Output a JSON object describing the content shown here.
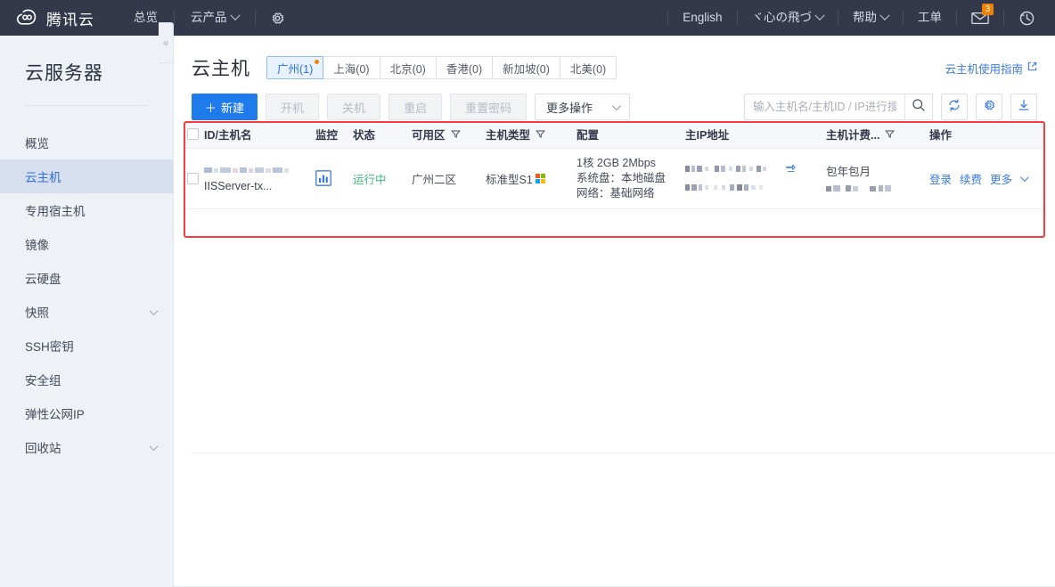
{
  "header": {
    "brand": "腾讯云",
    "brand_logo_icon": "cloud-logo-icon",
    "nav": [
      {
        "label": "总览",
        "icon": null,
        "caret": false
      },
      {
        "label": "云产品",
        "icon": null,
        "caret": true
      },
      {
        "label": "",
        "icon": "gear-icon",
        "caret": false
      }
    ],
    "right": [
      {
        "label": "English",
        "icon": null,
        "caret": false
      },
      {
        "label": "ヾ心の飛づ",
        "icon": null,
        "caret": true
      },
      {
        "label": "帮助",
        "icon": null,
        "caret": true
      },
      {
        "label": "工单",
        "icon": null,
        "caret": false
      },
      {
        "label": "",
        "icon": "mail-icon",
        "caret": false,
        "badge": "3"
      },
      {
        "label": "",
        "icon": "history-clock-icon",
        "caret": false
      }
    ],
    "badge_count": "3",
    "bg_color": "#33384a"
  },
  "sidebar": {
    "title": "云服务器",
    "collapse_icon": "«",
    "items": [
      {
        "label": "概览",
        "active": false,
        "expandable": false
      },
      {
        "label": "云主机",
        "active": true,
        "expandable": false
      },
      {
        "label": "专用宿主机",
        "active": false,
        "expandable": false
      },
      {
        "label": "镜像",
        "active": false,
        "expandable": false
      },
      {
        "label": "云硬盘",
        "active": false,
        "expandable": false
      },
      {
        "label": "快照",
        "active": false,
        "expandable": true
      },
      {
        "label": "SSH密钥",
        "active": false,
        "expandable": false
      },
      {
        "label": "安全组",
        "active": false,
        "expandable": false
      },
      {
        "label": "弹性公网IP",
        "active": false,
        "expandable": false
      },
      {
        "label": "回收站",
        "active": false,
        "expandable": true
      }
    ],
    "active_color": "#2b6fe0"
  },
  "main": {
    "page_title": "云主机",
    "region_tabs": [
      {
        "label": "广州(1)",
        "active": true,
        "dot": true
      },
      {
        "label": "上海(0)",
        "active": false,
        "dot": false
      },
      {
        "label": "北京(0)",
        "active": false,
        "dot": false
      },
      {
        "label": "香港(0)",
        "active": false,
        "dot": false
      },
      {
        "label": "新加坡(0)",
        "active": false,
        "dot": false
      },
      {
        "label": "北美(0)",
        "active": false,
        "dot": false
      }
    ],
    "guide_link": "云主机使用指南",
    "guide_link_icon": "external-link-icon",
    "toolbar": {
      "create_label": "新建",
      "create_plus": "＋",
      "buttons": [
        {
          "label": "开机",
          "disabled": true
        },
        {
          "label": "关机",
          "disabled": true
        },
        {
          "label": "重启",
          "disabled": true
        },
        {
          "label": "重置密码",
          "disabled": true
        }
      ],
      "more_label": "更多操作",
      "search_placeholder": "输入主机名/主机ID / IP进行搜索",
      "search_value": "",
      "search_icon": "search-icon",
      "refresh_icon": "refresh-icon",
      "settings_icon": "gear-icon",
      "download_icon": "download-icon"
    },
    "table": {
      "columns": [
        {
          "label": "ID/主机名",
          "filter": false
        },
        {
          "label": "监控",
          "filter": false
        },
        {
          "label": "状态",
          "filter": false
        },
        {
          "label": "可用区",
          "filter": true
        },
        {
          "label": "主机类型",
          "filter": true
        },
        {
          "label": "配置",
          "filter": false
        },
        {
          "label": "主IP地址",
          "filter": false
        },
        {
          "label": "主机计费...",
          "filter": true
        },
        {
          "label": "操作",
          "filter": false
        }
      ],
      "rows": [
        {
          "id_redacted": true,
          "hostname": "IISServer-tx...",
          "monitor_icon": "bar-chart-monitor-icon",
          "status": "运行中",
          "status_color": "#3fbb7d",
          "zone": "广州二区",
          "host_type": "标准型S1",
          "os_icon": "windows-logo-icon",
          "config_lines": [
            "1核 2GB 2Mbps",
            "系统盘：本地磁盘",
            "网络：基础网络"
          ],
          "ip_redacted": true,
          "ip_swap_icon": "swap-ip-icon",
          "billing": "包年包月",
          "billing_detail_redacted": true,
          "actions": [
            "登录",
            "续费",
            "更多"
          ],
          "actions_caret": true
        }
      ]
    },
    "highlight_box_color": "#fa3c41"
  }
}
